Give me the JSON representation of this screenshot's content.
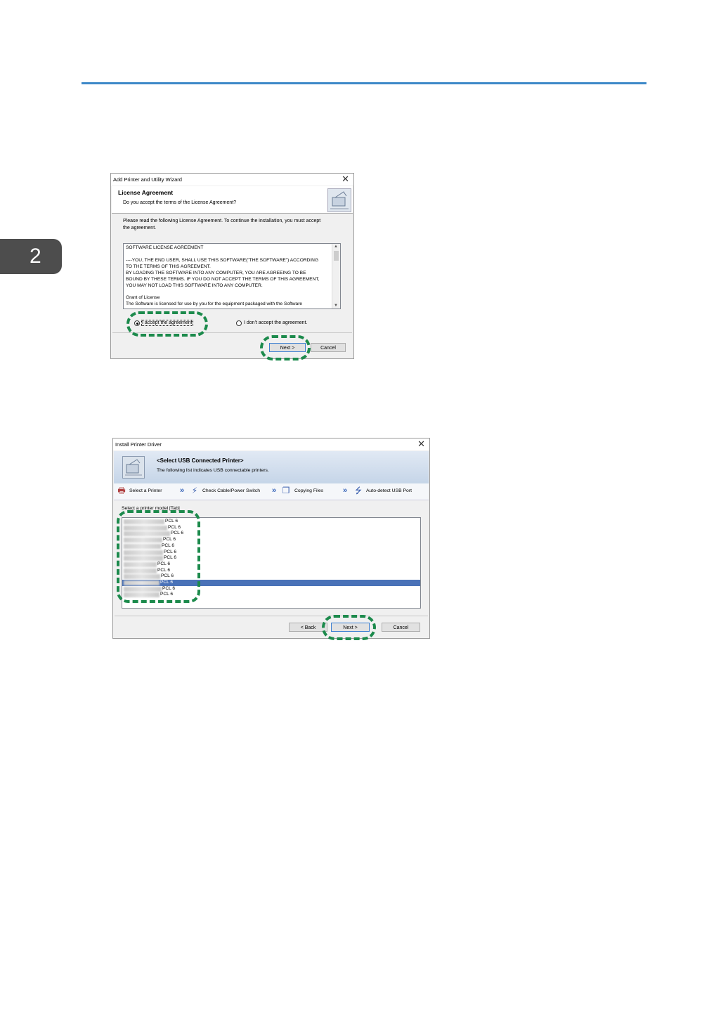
{
  "page": {
    "chapter_tab": "2"
  },
  "dialog1": {
    "title": "Add Printer and Utility Wizard",
    "header_title": "License Agreement",
    "header_subtitle": "Do you accept the terms of the License Agreement?",
    "intro_line1": "Please read the following License Agreement. To continue the installation, you must accept",
    "intro_line2": "the agreement.",
    "license_lines": [
      "SOFTWARE LICENSE AGREEMENT",
      "",
      "----YOU, THE END USER, SHALL USE THIS SOFTWARE(\"THE SOFTWARE\") ACCORDING",
      "TO THE TERMS OF THIS AGREEMENT.",
      "BY LOADING THE SOFTWARE INTO ANY COMPUTER, YOU ARE AGREEING TO BE",
      "BOUND BY THESE TERMS. IF YOU DO NOT ACCEPT THE TERMS OF THIS AGREEMENT,",
      "YOU MAY NOT LOAD THIS SOFTWARE INTO ANY COMPUTER.",
      "",
      "Grant of License",
      "The Software is licensed for use by you for the equipment packaged with the Software"
    ],
    "radio_accept": "I accept the agreement",
    "radio_decline": "I don't accept the agreement.",
    "accept_selected": true,
    "next_label": "Next >",
    "cancel_label": "Cancel"
  },
  "dialog2": {
    "title": "Install Printer Driver",
    "banner_title": "<Select USB Connected Printer>",
    "banner_subtitle": "The following list indicates USB connectable printers.",
    "steps": [
      {
        "label": "Select a Printer",
        "icon": "printer-icon"
      },
      {
        "label": "Check Cable/Power Switch",
        "icon": "plug-icon"
      },
      {
        "label": "Copying Files",
        "icon": "copy-files-icon"
      },
      {
        "label": "Auto-detect USB Port",
        "icon": "usb-icon"
      }
    ],
    "list_label": "Select a printer model [Tab]",
    "printers": [
      {
        "suffix": "PCL 6",
        "selected": false
      },
      {
        "suffix": "PCL 6",
        "selected": false
      },
      {
        "suffix": "PCL 6",
        "selected": false
      },
      {
        "suffix": "PCL 6",
        "selected": false
      },
      {
        "suffix": "PCL 6",
        "selected": false
      },
      {
        "suffix": "PCL 6",
        "selected": false
      },
      {
        "suffix": "PCL 6",
        "selected": false
      },
      {
        "suffix": "PCL 6",
        "selected": false
      },
      {
        "suffix": "PCL 6",
        "selected": false
      },
      {
        "suffix": "PCL 6",
        "selected": false
      },
      {
        "suffix": "PCL 6",
        "selected": true
      },
      {
        "suffix": "PCL 6",
        "selected": false
      },
      {
        "suffix": "PCL 6",
        "selected": false
      }
    ],
    "back_label": "< Back",
    "next_label": "Next >",
    "cancel_label": "Cancel"
  },
  "colors": {
    "accent_rule": "#3d88c8",
    "callout": "#1c8a4c",
    "selection": "#4a72b8"
  }
}
